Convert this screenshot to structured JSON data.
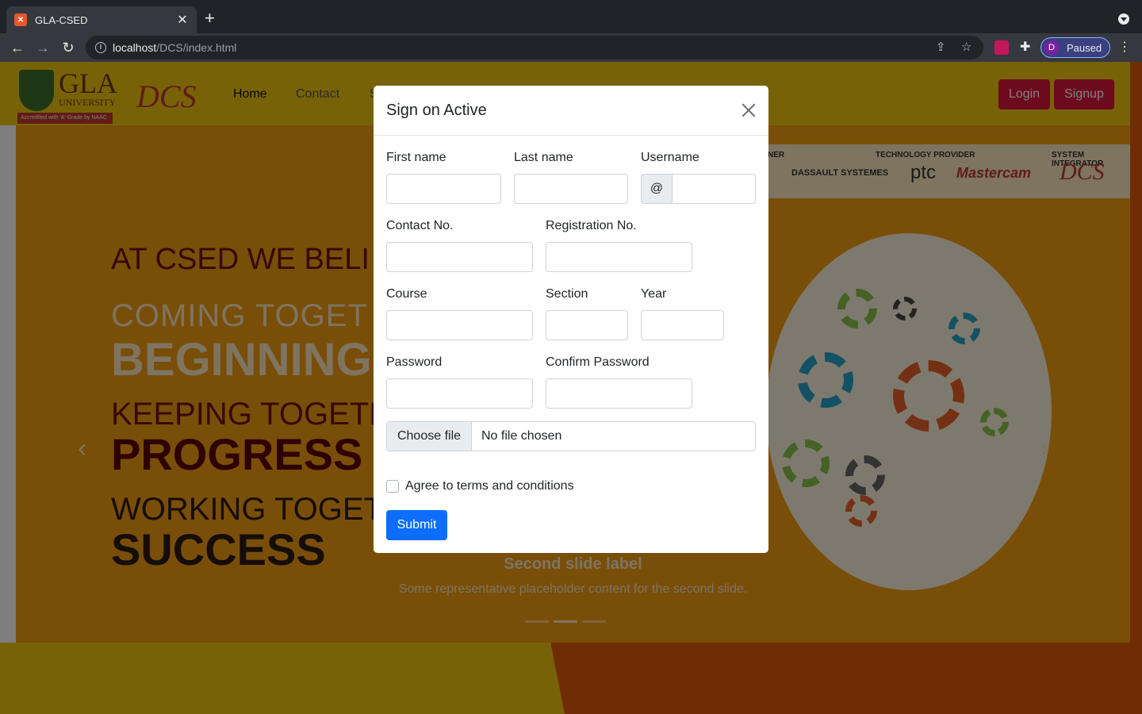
{
  "browser": {
    "tab_title": "GLA-CSED",
    "tab_favicon": "xampp-icon",
    "url_host": "localhost",
    "url_path": "/DCS/index.html",
    "profile_initial": "D",
    "profile_status": "Paused"
  },
  "site": {
    "logo_gla": "GLA",
    "logo_gla_sub": "UNIVERSITY",
    "logo_gla_bar": "Accredited with 'A' Grade by NAAC",
    "logo_dcs": "DCS",
    "nav": [
      "Home",
      "Contact",
      "S"
    ],
    "login_label": "Login",
    "signup_label": "Signup",
    "hero_lines": [
      "AT CSED WE BELI",
      "COMING TOGET",
      "BEGINNING",
      "KEEPING TOGETH",
      "PROGRESS",
      "WORKING TOGET",
      "SUCCESS"
    ],
    "partner_labels": [
      "NER",
      "TECHNOLOGY PROVIDER",
      "SYSTEM INTEGRATOR"
    ],
    "partner_logos": [
      "DASSAULT SYSTEMES",
      "ptc",
      "Mastercam",
      "DCS"
    ],
    "caption_title": "Second slide label",
    "caption_text": "Some representative placeholder content for the second slide.",
    "slide_count": 3,
    "active_slide": 2
  },
  "modal": {
    "title": "Sign on Active",
    "fields": {
      "first_name_label": "First name",
      "last_name_label": "Last name",
      "username_label": "Username",
      "username_prefix": "@",
      "contact_label": "Contact No.",
      "registration_label": "Registration No.",
      "course_label": "Course",
      "section_label": "Section",
      "year_label": "Year",
      "password_label": "Password",
      "confirm_password_label": "Confirm Password"
    },
    "file_button": "Choose file",
    "file_status": "No file chosen",
    "terms_label": "Agree to terms and conditions",
    "terms_checked": false,
    "submit_label": "Submit"
  },
  "colors": {
    "accent": "#0d6efd",
    "brand_red": "#dc143c",
    "nav_yellow": "#f1c40f",
    "hero_orange": "#f39c12"
  }
}
